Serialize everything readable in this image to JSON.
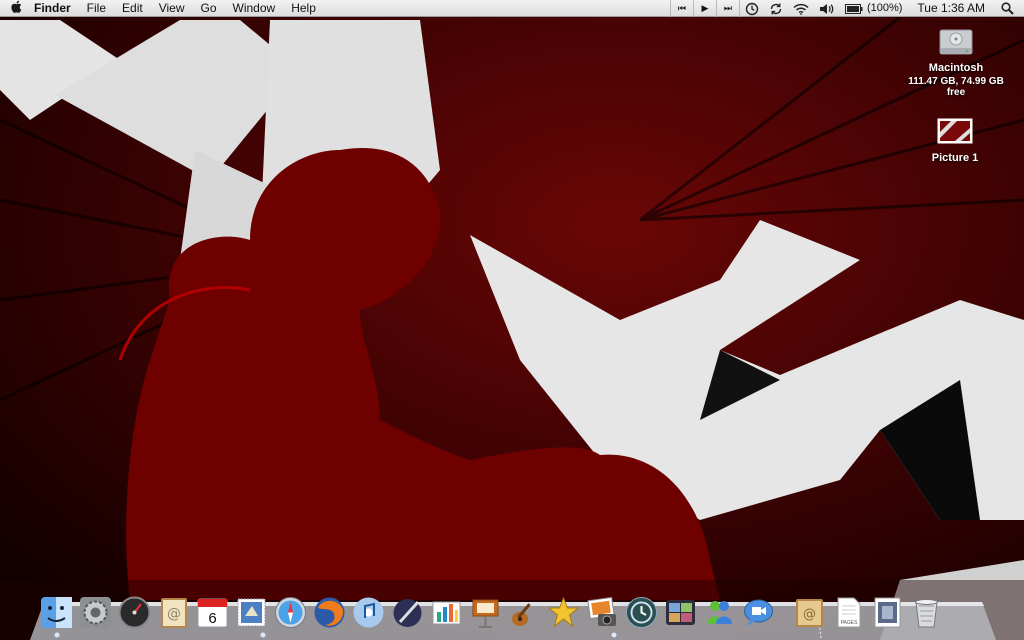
{
  "menubar": {
    "apple_glyph": "",
    "app_name": "Finder",
    "items": [
      "File",
      "Edit",
      "View",
      "Go",
      "Window",
      "Help"
    ],
    "battery_percent": "(100%)",
    "clock": "Tue 1:36 AM"
  },
  "desktop": {
    "hd_name": "Macintosh",
    "hd_info": "111.47 GB, 74.99 GB free",
    "picture_name": "Picture 1"
  },
  "dock": {
    "apps": [
      "finder-icon",
      "system-preferences-icon",
      "dashboard-icon",
      "address-book-icon",
      "ical-icon",
      "mail-stamp-icon",
      "safari-icon",
      "firefox-icon",
      "itunes-icon",
      "inkwell-icon",
      "numbers-icon",
      "keynote-icon",
      "garageband-icon",
      "imovie-icon",
      "iphoto-icon",
      "time-machine-icon",
      "spaces-icon",
      "msn-messenger-icon",
      "ichat-icon"
    ],
    "stacks": [
      "mail-folder-icon",
      "pages-document-icon",
      "downloads-stack-icon",
      "trash-icon"
    ],
    "ical_day": "6",
    "pages_label": "PAGES"
  },
  "colors": {
    "wallpaper_dark": "#1a0000",
    "wallpaper_red": "#7a0808",
    "menubar": "#e8e8e8"
  }
}
